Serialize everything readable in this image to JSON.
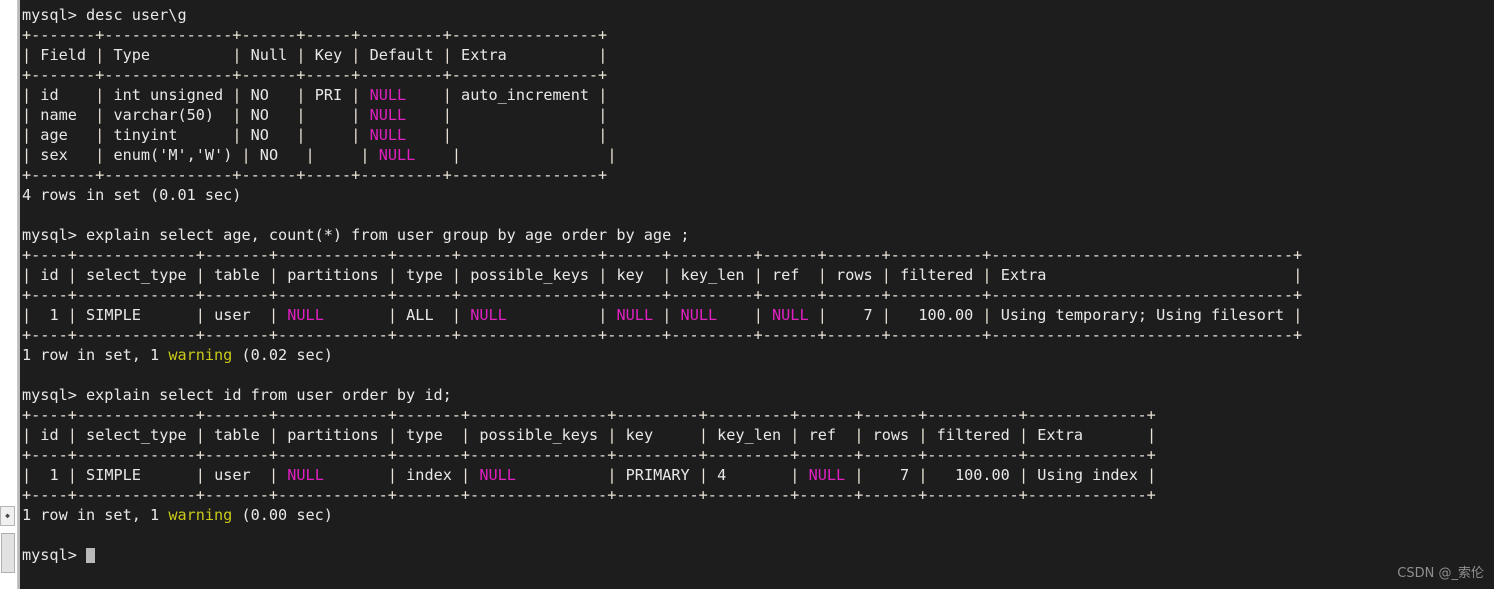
{
  "terminal": {
    "background_color": "#1d1d1d",
    "foreground_color": "#e8e8e8",
    "null_color": "#e020c0",
    "warning_color": "#c9c919",
    "prompt": "mysql> ",
    "cursor": "block"
  },
  "scrollbar": {
    "arrow_glyph": "◆"
  },
  "watermark": "CSDN @_索伦",
  "blocks": [
    {
      "id": "block-desc-user",
      "command_prompt": "mysql> ",
      "command": "desc user\\g",
      "table": {
        "rule_top": "+-------+--------------+------+-----+---------+----------------+",
        "rule_mid": "+-------+--------------+------+-----+---------+----------------+",
        "rule_bottom": "+-------+--------------+------+-----+---------+----------------+",
        "headers": [
          "Field",
          "Type",
          "Null",
          "Key",
          "Default",
          "Extra"
        ],
        "header_line_parts": [
          {
            "t": "| ",
            "c": "rule"
          },
          {
            "t": "Field",
            "c": "default"
          },
          {
            "t": " | ",
            "c": "rule"
          },
          {
            "t": "Type         ",
            "c": "default"
          },
          {
            "t": " | ",
            "c": "rule"
          },
          {
            "t": "Null",
            "c": "null"
          },
          {
            "t": " | ",
            "c": "rule"
          },
          {
            "t": "Key",
            "c": "default"
          },
          {
            "t": " | ",
            "c": "rule"
          },
          {
            "t": "Default",
            "c": "default"
          },
          {
            "t": " | ",
            "c": "rule"
          },
          {
            "t": "Extra          ",
            "c": "default"
          },
          {
            "t": "|",
            "c": "rule"
          }
        ],
        "rows": [
          {
            "Field": "id",
            "Type": "int unsigned",
            "Null": "NO",
            "Key": "PRI",
            "Default": "NULL",
            "Extra": "auto_increment"
          },
          {
            "Field": "name",
            "Type": "varchar(50)",
            "Null": "NO",
            "Key": "",
            "Default": "NULL",
            "Extra": ""
          },
          {
            "Field": "age",
            "Type": "tinyint",
            "Null": "NO",
            "Key": "",
            "Default": "NULL",
            "Extra": ""
          },
          {
            "Field": "sex",
            "Type": "enum('M','W')",
            "Null": "NO",
            "Key": "",
            "Default": "NULL",
            "Extra": ""
          }
        ]
      },
      "status": {
        "text_before": "4 rows in set (0.01 sec)",
        "rows": 4,
        "warnings": 0,
        "time": "0.01 sec"
      }
    },
    {
      "id": "block-explain-group-by-age",
      "command_prompt": "mysql> ",
      "command": "explain select age, count(*) from user group by age order by age ;",
      "table": {
        "rule": "+----+-------------+-------+------------+------+---------------+------+---------+------+------+----------+---------------------------------+",
        "headers": [
          "id",
          "select_type",
          "table",
          "partitions",
          "type",
          "possible_keys",
          "key",
          "key_len",
          "ref",
          "rows",
          "filtered",
          "Extra"
        ],
        "rows": [
          {
            "id": "1",
            "select_type": "SIMPLE",
            "table": "user",
            "partitions": "NULL",
            "type": "ALL",
            "possible_keys": "NULL",
            "key": "NULL",
            "key_len": "NULL",
            "ref": "NULL",
            "rows": "7",
            "filtered": "100.00",
            "Extra": "Using temporary; Using filesort"
          }
        ]
      },
      "status": {
        "text_before": "1 row in set, ",
        "warn_count": "1",
        "warn_word": " warning",
        "text_after": " (0.02 sec)",
        "rows": 1,
        "warnings": 1,
        "time": "0.02 sec"
      }
    },
    {
      "id": "block-explain-order-by-id",
      "command_prompt": "mysql> ",
      "command": "explain select id from user order by id;",
      "table": {
        "rule": "+----+-------------+-------+------------+-------+---------------+---------+---------+------+------+----------+-------------+",
        "headers": [
          "id",
          "select_type",
          "table",
          "partitions",
          "type",
          "possible_keys",
          "key",
          "key_len",
          "ref",
          "rows",
          "filtered",
          "Extra"
        ],
        "rows": [
          {
            "id": "1",
            "select_type": "SIMPLE",
            "table": "user",
            "partitions": "NULL",
            "type": "index",
            "possible_keys": "NULL",
            "key": "PRIMARY",
            "key_len": "4",
            "ref": "NULL",
            "rows": "7",
            "filtered": "100.00",
            "Extra": "Using index"
          }
        ]
      },
      "status": {
        "text_before": "1 row in set, ",
        "warn_count": "1",
        "warn_word": " warning",
        "text_after": " (0.00 sec)",
        "rows": 1,
        "warnings": 1,
        "time": "0.00 sec"
      }
    }
  ],
  "final_prompt": {
    "prompt": "mysql> "
  }
}
